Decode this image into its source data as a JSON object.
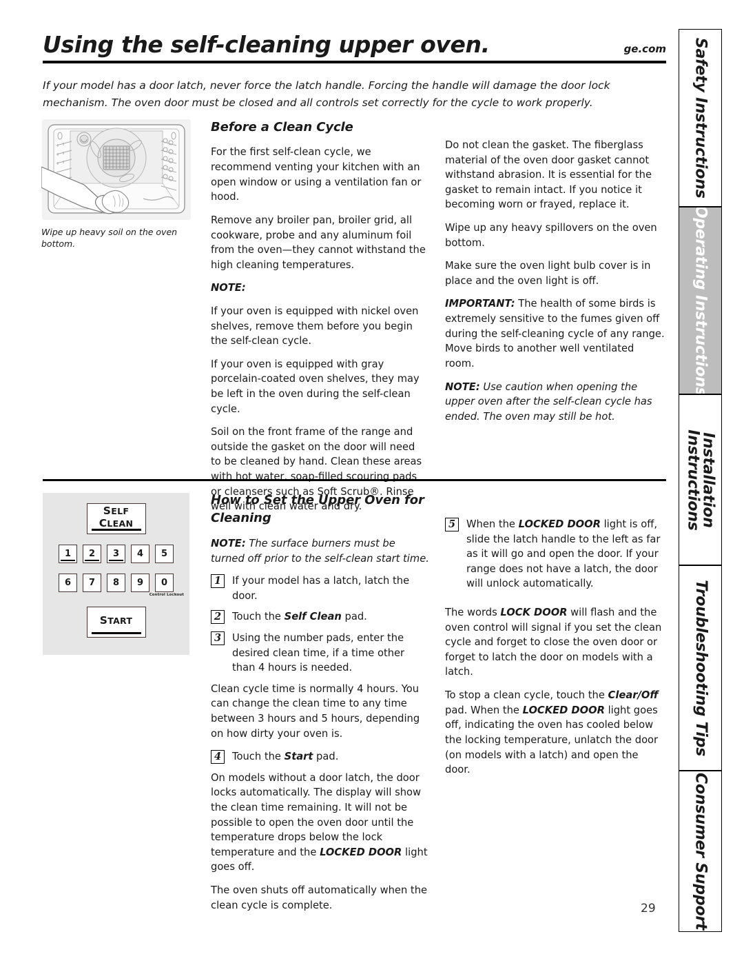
{
  "header": {
    "title": "Using the self-cleaning upper oven.",
    "site_url": "ge.com",
    "intro": "If your model has a door latch, never force the latch handle. Forcing the handle will damage the door lock mechanism. The oven door must be closed and all controls set correctly for the cycle to work properly."
  },
  "figures": {
    "oven": {
      "name": "oven-interior-wipe-illustration",
      "caption": "Wipe up heavy soil on the oven bottom."
    },
    "control_panel": {
      "name": "oven-control-panel-illustration",
      "self_clean_line1": "S",
      "self_clean_line1_rest": "ELF",
      "self_clean_line2": "C",
      "self_clean_line2_rest": "LEAN",
      "self_clean_label": "SELF CLEAN",
      "start_cap": "S",
      "start_rest": "TART",
      "start_label": "START",
      "number_row_1": [
        "1",
        "2",
        "3",
        "4",
        "5"
      ],
      "number_row_2": [
        "6",
        "7",
        "8",
        "9",
        "0"
      ],
      "control_lockout_label": "Control Lockout"
    }
  },
  "section_before": {
    "heading": "Before a Clean Cycle",
    "left_paragraphs": [
      "For the first self-clean cycle, we recommend venting your kitchen with an open window or using a ventilation fan or hood.",
      "Remove any broiler pan, broiler grid, all cookware, probe and any aluminum foil from the oven—they cannot withstand the high cleaning temperatures."
    ],
    "note_label": "NOTE:",
    "note_items": [
      "If your oven is equipped with nickel oven shelves, remove them before you begin the self-clean cycle.",
      "If your oven is equipped with gray porcelain-coated oven shelves, they may be left in the oven during the self-clean cycle."
    ],
    "left_paragraph_last": "Soil on the front frame of the range and outside the gasket on the door will need to be cleaned by hand. Clean these areas with hot water, soap-filled scouring pads or cleansers such as Soft Scrub®. Rinse well with clean water and dry.",
    "right_paragraphs": [
      "Do not clean the gasket. The fiberglass material of the oven door gasket cannot withstand abrasion. It is essential for the gasket to remain intact. If you notice it becoming worn or frayed, replace it.",
      "Wipe up any heavy spillovers on the oven bottom.",
      "Make sure the oven light bulb cover is in place and the oven light is off."
    ],
    "important_label": "IMPORTANT:",
    "important_text": "The health of some birds is extremely sensitive to the fumes given off during the self-cleaning cycle of any range. Move birds to another well ventilated room.",
    "right_note_label": "NOTE:",
    "right_note_text": "Use caution when opening the upper oven after the self-clean cycle has ended. The oven may still be hot."
  },
  "section_howto": {
    "heading": "How to Set the Upper Oven for Cleaning",
    "note_label": "NOTE:",
    "note_text": "The surface burners must be turned off prior to the self-clean start time.",
    "steps": [
      {
        "num": "1",
        "text_pre": "If your model has a latch, latch the door.",
        "bold": "",
        "text_post": ""
      },
      {
        "num": "2",
        "text_pre": "Touch the ",
        "bold": "Self Clean",
        "text_post": " pad."
      },
      {
        "num": "3",
        "text_pre": "Using the number pads, enter the desired clean time, if a time other than 4 hours is needed.",
        "bold": "",
        "text_post": ""
      },
      {
        "num": "4",
        "text_pre": "Touch the ",
        "bold": "Start",
        "text_post": " pad."
      }
    ],
    "after_step3_paragraph": "Clean cycle time is normally 4 hours. You can change the clean time to any time between 3 hours and 5 hours, depending on how dirty your oven is.",
    "after_step4_paragraph_pre": "On models without a door latch, the door locks automatically. The display will show the clean time remaining. It will not be possible to open the oven door until the temperature drops below the lock temperature and the ",
    "after_step4_bold": "LOCKED DOOR",
    "after_step4_paragraph_post": " light goes off.",
    "shutoff_paragraph": "The oven shuts off automatically when the clean cycle is complete.",
    "step5": {
      "num": "5",
      "pre": "When the ",
      "bold": "LOCKED DOOR",
      "post": " light is off, slide the latch handle to the left as far as it will go and open the door. If your range does not have a latch, the door will unlock automatically."
    },
    "lock_door_paragraph_pre": "The words ",
    "lock_door_bold": "LOCK DOOR",
    "lock_door_paragraph_post": " will flash and the oven control will signal if you set the clean cycle and forget to close the oven door or forget to latch the door on models with a latch.",
    "stop_paragraph_pre": "To stop a clean cycle, touch the ",
    "stop_bold_1": "Clear/Off",
    "stop_mid": " pad. When the ",
    "stop_bold_2": "LOCKED DOOR",
    "stop_post": " light goes off, indicating the oven has cooled below the locking temperature, unlatch the door (on models with a latch) and open the door."
  },
  "side_tabs": [
    {
      "label": "Safety Instructions",
      "active": false
    },
    {
      "label": "Operating Instructions",
      "active": true
    },
    {
      "label": "Installation\nInstructions",
      "active": false
    },
    {
      "label": "Troubleshooting Tips",
      "active": false
    },
    {
      "label": "Consumer Support",
      "active": false
    }
  ],
  "page_number": "29",
  "colors": {
    "active_tab_bg": "#bdbdbd",
    "panel_bg": "#e6e6e6",
    "text": "#1a1a1a"
  }
}
